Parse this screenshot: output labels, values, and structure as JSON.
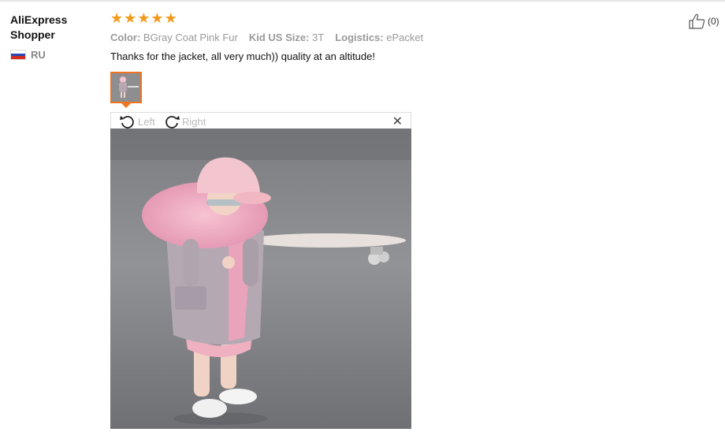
{
  "review": {
    "author_name": "AliExpress Shopper",
    "country_code": "RU",
    "rating": 5,
    "attributes": [
      {
        "key": "Color:",
        "value": "BGray Coat Pink Fur"
      },
      {
        "key": "Kid US Size:",
        "value": "3T"
      },
      {
        "key": "Logistics:",
        "value": "ePacket"
      }
    ],
    "text": "Thanks for the jacket, all very much)) quality at an altitude!",
    "helpful_count": "(0)"
  },
  "viewer": {
    "rotate_left_label": "Left",
    "rotate_right_label": "Right",
    "close_glyph": "✕"
  },
  "colors": {
    "star": "#f39a1c",
    "thumb_border": "#f0731f",
    "attr_text": "#999999",
    "flag_colors": [
      "#ffffff",
      "#2a48b5",
      "#d52b1e"
    ]
  },
  "icons": {
    "rating": "star-icon",
    "like": "thumbs-up-icon",
    "rotate_left": "rotate-left-icon",
    "rotate_right": "rotate-right-icon",
    "close": "close-icon",
    "flag": "flag-ru-icon"
  }
}
